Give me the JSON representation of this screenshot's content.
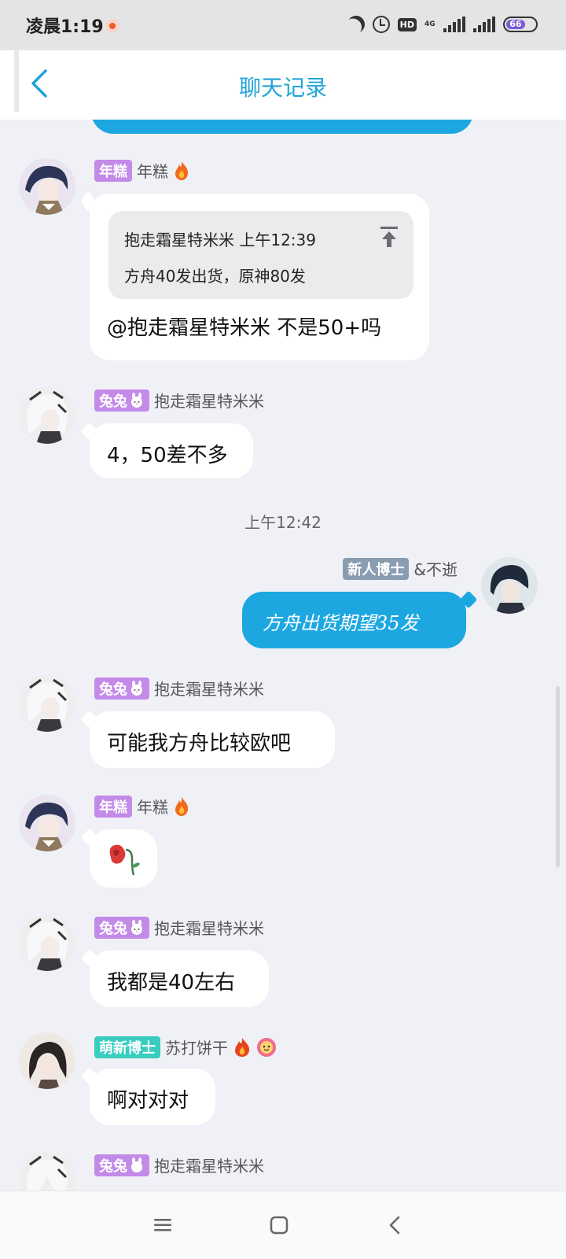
{
  "status_bar": {
    "time": "凌晨1:19",
    "hd": "HD",
    "network": "4G",
    "battery": "66",
    "battery_level": 0.66,
    "icons": [
      "record-indicator-icon",
      "moon-icon",
      "alarm-icon",
      "hd-icon",
      "signal-icon",
      "signal-icon",
      "battery-icon"
    ]
  },
  "header": {
    "title": "聊天记录",
    "back_icon": "chevron-left-icon"
  },
  "colors": {
    "accent": "#20a3d8",
    "my_bubble": "#1da7e0",
    "badge_purple": "#c38ae8",
    "badge_teal": "#38cdbf",
    "badge_gray": "#8a9db0"
  },
  "messages": [
    {
      "badge": "年糕",
      "name": "年糕",
      "name_icon": "fire-icon",
      "quote": {
        "line1": "抱走霜星特米米 上午12:39",
        "line2": "方舟40发出货，原神80发"
      },
      "text": "@抱走霜星特米米 不是50+吗"
    },
    {
      "badge": "兔兔",
      "badge_icon": "rabbit-icon",
      "name": "抱走霜星特米米",
      "text": "4，50差不多"
    },
    {
      "timestamp": "上午12:42"
    },
    {
      "badge": "新人博士",
      "name": "&不逝",
      "text": "方舟出货期望35发",
      "mine": true
    },
    {
      "badge": "兔兔",
      "badge_icon": "rabbit-icon",
      "name": "抱走霜星特米米",
      "text": "可能我方舟比较欧吧"
    },
    {
      "badge": "年糕",
      "name": "年糕",
      "name_icon": "fire-icon",
      "sticker": "wilted-rose-icon"
    },
    {
      "badge": "兔兔",
      "badge_icon": "rabbit-icon",
      "name": "抱走霜星特米米",
      "text": "我都是40左右"
    },
    {
      "badge": "萌新博士",
      "name": "苏打饼干",
      "name_icons": [
        "fire-icon",
        "flower-face-icon"
      ],
      "text": "啊对对对"
    },
    {
      "badge": "兔兔",
      "badge_icon": "rabbit-icon",
      "name": "抱走霜星特米米"
    }
  ],
  "nav_bar": {
    "icons": [
      "menu-icon",
      "home-icon",
      "back-icon"
    ]
  }
}
